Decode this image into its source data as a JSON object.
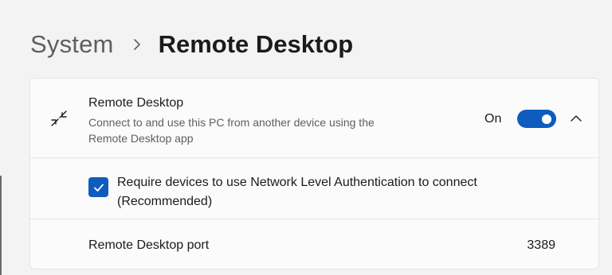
{
  "breadcrumb": {
    "parent": "System",
    "current": "Remote Desktop"
  },
  "remote_desktop": {
    "title": "Remote Desktop",
    "description": "Connect to and use this PC from another device using the Remote Desktop app",
    "icon": "remote-desktop-icon",
    "toggle_state_label": "On",
    "toggle_on": true,
    "expanded": true
  },
  "nla": {
    "label": "Require devices to use Network Level Authentication to connect (Recommended)",
    "checked": true
  },
  "port": {
    "label": "Remote Desktop port",
    "value": "3389"
  },
  "colors": {
    "accent": "#0f5cbf",
    "background": "#f3f3f3",
    "card": "#fbfbfb"
  }
}
